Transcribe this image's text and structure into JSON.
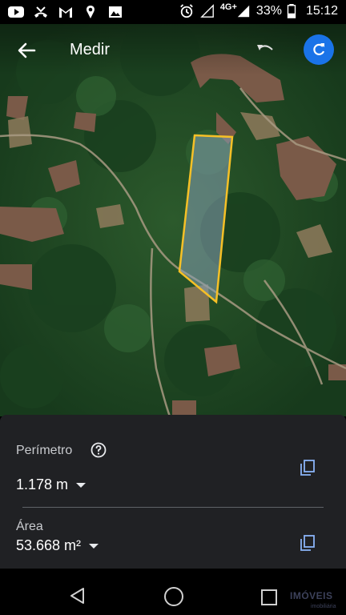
{
  "status_bar": {
    "left_icons": [
      "youtube-icon",
      "missed-call-icon",
      "gmail-icon",
      "location-icon",
      "image-icon"
    ],
    "alarm_icon": "alarm-icon",
    "network_label": "4G+",
    "battery_percent": "33%",
    "time": "15:12"
  },
  "app_bar": {
    "title": "Medir",
    "back_icon": "arrow-left-icon",
    "undo_icon": "undo-icon",
    "refresh_icon": "refresh-icon",
    "accent_color": "#1a73e8"
  },
  "map": {
    "measurement_outline_color": "#f6c026"
  },
  "measurements": {
    "perimeter": {
      "label": "Perímetro",
      "value": "1.178 m"
    },
    "area": {
      "label": "Área",
      "value": "53.668 m²"
    }
  },
  "nav_bar": {
    "buttons": [
      "back",
      "home",
      "recents"
    ]
  },
  "watermark": {
    "brand": "IMÓVEIS",
    "sub": "imobiliária"
  }
}
